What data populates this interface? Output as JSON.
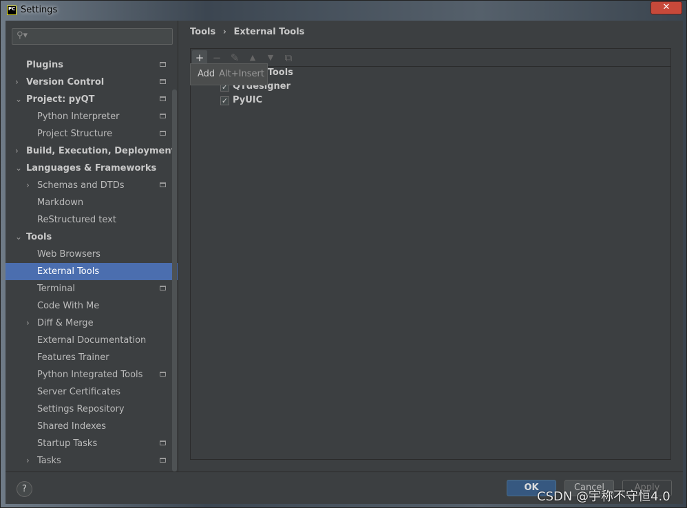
{
  "window": {
    "title": "Settings",
    "close": "✕",
    "icon_text": "PC"
  },
  "search": {
    "placeholder": "",
    "icon": "search-icon"
  },
  "tree": [
    {
      "label": "Plugins",
      "level": 0,
      "bold": true,
      "arrow": "",
      "project": true
    },
    {
      "label": "Version Control",
      "level": 0,
      "bold": true,
      "arrow": "›",
      "project": true
    },
    {
      "label": "Project: pyQT",
      "level": 0,
      "bold": true,
      "arrow": "⌄",
      "project": true
    },
    {
      "label": "Python Interpreter",
      "level": 1,
      "arrow": "",
      "project": true
    },
    {
      "label": "Project Structure",
      "level": 1,
      "arrow": "",
      "project": true
    },
    {
      "label": "Build, Execution, Deployment",
      "level": 0,
      "bold": true,
      "arrow": "›",
      "project": false
    },
    {
      "label": "Languages & Frameworks",
      "level": 0,
      "bold": true,
      "arrow": "⌄",
      "project": false
    },
    {
      "label": "Schemas and DTDs",
      "level": 1,
      "arrow": "›",
      "project": true
    },
    {
      "label": "Markdown",
      "level": 1,
      "arrow": "",
      "project": false
    },
    {
      "label": "ReStructured text",
      "level": 1,
      "arrow": "",
      "project": false
    },
    {
      "label": "Tools",
      "level": 0,
      "bold": true,
      "arrow": "⌄",
      "project": false
    },
    {
      "label": "Web Browsers",
      "level": 1,
      "arrow": "",
      "project": false
    },
    {
      "label": "External Tools",
      "level": 1,
      "arrow": "",
      "project": false,
      "selected": true
    },
    {
      "label": "Terminal",
      "level": 1,
      "arrow": "",
      "project": true
    },
    {
      "label": "Code With Me",
      "level": 1,
      "arrow": "",
      "project": false
    },
    {
      "label": "Diff & Merge",
      "level": 1,
      "arrow": "›",
      "project": false
    },
    {
      "label": "External Documentation",
      "level": 1,
      "arrow": "",
      "project": false
    },
    {
      "label": "Features Trainer",
      "level": 1,
      "arrow": "",
      "project": false
    },
    {
      "label": "Python Integrated Tools",
      "level": 1,
      "arrow": "",
      "project": true
    },
    {
      "label": "Server Certificates",
      "level": 1,
      "arrow": "",
      "project": false
    },
    {
      "label": "Settings Repository",
      "level": 1,
      "arrow": "",
      "project": false
    },
    {
      "label": "Shared Indexes",
      "level": 1,
      "arrow": "",
      "project": false
    },
    {
      "label": "Startup Tasks",
      "level": 1,
      "arrow": "",
      "project": true
    },
    {
      "label": "Tasks",
      "level": 1,
      "arrow": "›",
      "project": true
    }
  ],
  "breadcrumb": {
    "parent": "Tools",
    "sep": "›",
    "current": "External Tools"
  },
  "toolbar": {
    "add": "+",
    "remove": "−",
    "edit": "✎",
    "up": "▲",
    "down": "▼",
    "copy": "⧉"
  },
  "tooltip": {
    "label": "Add",
    "shortcut": "Alt+Insert"
  },
  "tools_list": {
    "group": "External Tools",
    "items": [
      {
        "label": "QTdesigner",
        "checked": true
      },
      {
        "label": "PyUIC",
        "checked": true
      }
    ],
    "check": "✓"
  },
  "buttons": {
    "help": "?",
    "ok": "OK",
    "cancel": "Cancel",
    "apply": "Apply"
  },
  "watermark": "CSDN @宇称不守恒4.0"
}
